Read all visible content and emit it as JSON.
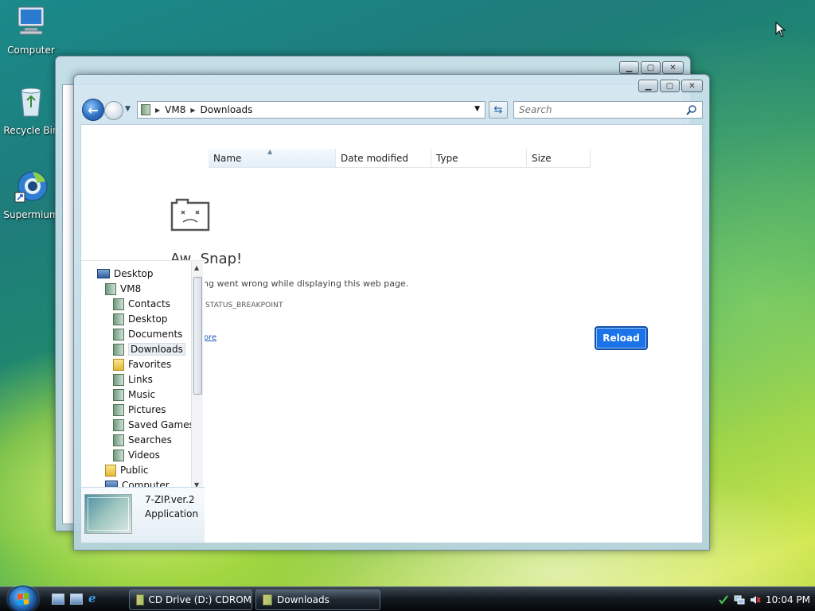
{
  "desktop": {
    "icons": [
      {
        "label": "Computer",
        "icon": "computer-icon"
      },
      {
        "label": "Recycle Bin",
        "icon": "recycle-bin-icon"
      },
      {
        "label": "Supermium",
        "icon": "supermium-icon"
      }
    ]
  },
  "explorer": {
    "address": {
      "crumbs": [
        "VM8",
        "Downloads"
      ]
    },
    "search": {
      "placeholder": "Search"
    },
    "columns": [
      "Name",
      "Date modified",
      "Type",
      "Size"
    ],
    "error": {
      "title": "Aw, Snap!",
      "message": "ing went wrong while displaying this web page.",
      "code": "STATUS_BREAKPOINT",
      "link": "ore",
      "reload_label": "Reload"
    },
    "tree": [
      {
        "label": "Desktop",
        "icon": "desktop-icon"
      },
      {
        "label": "VM8",
        "icon": "user-folder-icon"
      },
      {
        "label": "Contacts",
        "icon": "contacts-icon"
      },
      {
        "label": "Desktop",
        "icon": "desktop-folder-icon"
      },
      {
        "label": "Documents",
        "icon": "documents-icon"
      },
      {
        "label": "Downloads",
        "icon": "downloads-icon",
        "selected": true
      },
      {
        "label": "Favorites",
        "icon": "favorites-icon"
      },
      {
        "label": "Links",
        "icon": "links-icon"
      },
      {
        "label": "Music",
        "icon": "music-icon"
      },
      {
        "label": "Pictures",
        "icon": "pictures-icon"
      },
      {
        "label": "Saved Games",
        "icon": "saved-games-icon"
      },
      {
        "label": "Searches",
        "icon": "searches-icon"
      },
      {
        "label": "Videos",
        "icon": "videos-icon"
      },
      {
        "label": "Public",
        "icon": "public-folder-icon"
      },
      {
        "label": "Computer",
        "icon": "computer-icon"
      }
    ],
    "details": {
      "name": "7-ZIP.ver.2",
      "type": "Application"
    }
  },
  "taskbar": {
    "buttons": [
      {
        "label": "CD Drive (D:) CDROM",
        "icon": "cd-drive-icon"
      },
      {
        "label": "Downloads",
        "icon": "folder-icon"
      }
    ],
    "clock": "10:04 PM"
  },
  "colors": {
    "accent": "#1a73e8",
    "taskbar": "#161c22"
  }
}
